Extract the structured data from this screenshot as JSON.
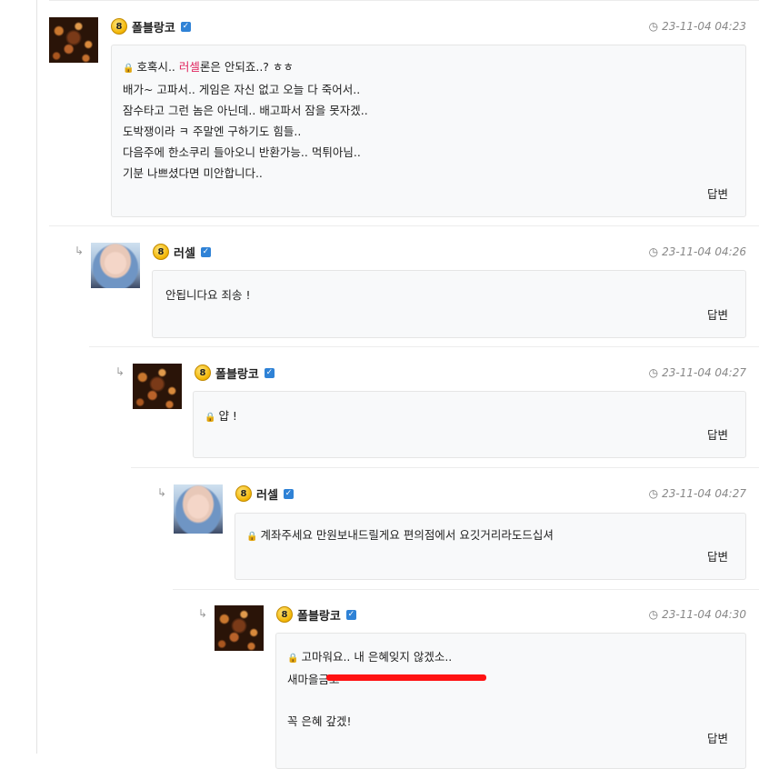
{
  "comments": [
    {
      "user": "폴블랑코",
      "level": "8",
      "datetime": "23-11-04 04:23",
      "text_prefix": "호혹시.. ",
      "text_highlight": "러셀",
      "text_suffix": "론은 안되죠..? ㅎㅎ",
      "lines": [
        "배가~ 고파서.. 게임은 자신 없고 오늘 다 죽어서..",
        "잠수타고 그런 놈은 아닌데.. 배고파서 잠을 못자겠..",
        "도박쟁이라 ㅋ 주말엔 구하기도 힘들..",
        "다음주에 한소쿠리 들아오니 반환가능.. 먹튀아님..",
        "기분 나쁘셨다면 미안합니다.."
      ],
      "reply_label": "답변"
    },
    {
      "user": "러셀",
      "level": "8",
      "datetime": "23-11-04 04:26",
      "text": "안됩니다요 죄송 !",
      "reply_label": "답변"
    },
    {
      "user": "폴블랑코",
      "level": "8",
      "datetime": "23-11-04 04:27",
      "text": "얍 !",
      "reply_label": "답변"
    },
    {
      "user": "러셀",
      "level": "8",
      "datetime": "23-11-04 04:27",
      "text": "계좌주세요 만원보내드릴게요 편의점에서 요깃거리라도드십셔",
      "reply_label": "답변"
    },
    {
      "user": "폴블랑코",
      "level": "8",
      "datetime": "23-11-04 04:30",
      "line1": "고마워요.. 내 은혜잊지 않겠소..",
      "line2": "새마을금고 ",
      "line4": "꼭 은혜 갚겠!",
      "reply_label": "답변"
    }
  ],
  "icons": {
    "reply_arrow": "↳",
    "clock": "◷",
    "lock": "🔒",
    "verify": "✓"
  },
  "colors": {
    "highlight": "#e0245e",
    "verify": "#2f82d6",
    "redaction": "#ff1212"
  }
}
